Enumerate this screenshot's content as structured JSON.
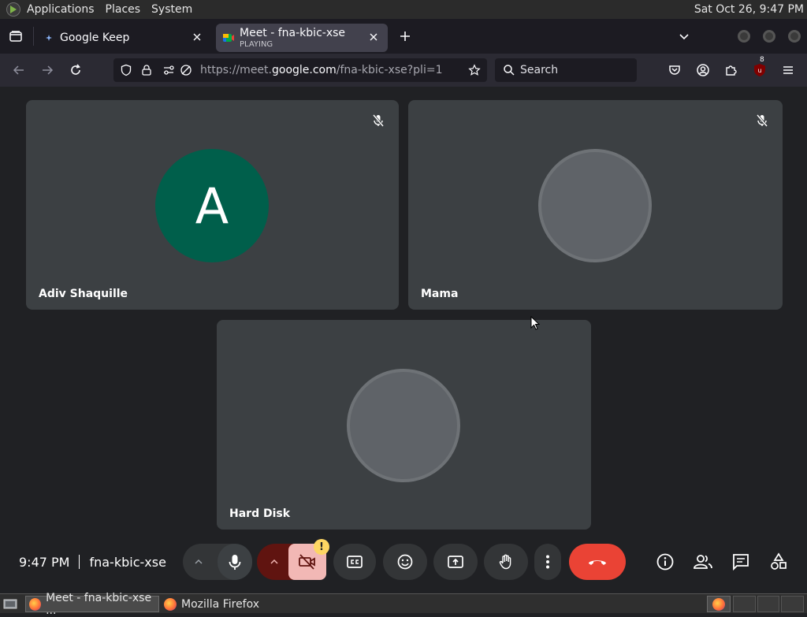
{
  "system_bar": {
    "menus": [
      "Applications",
      "Places",
      "System"
    ],
    "clock": "Sat Oct 26,  9:47 PM"
  },
  "tabs": [
    {
      "title": "Google Keep",
      "subtitle": ""
    },
    {
      "title": "Meet - fna-kbic-xse",
      "subtitle": "PLAYING"
    }
  ],
  "navbar": {
    "url_prefix": "https://meet.",
    "url_domain": "google.com",
    "url_path": "/fna-kbic-xse?pli=1",
    "search_placeholder": "Search",
    "extension_badge": "8"
  },
  "participants": [
    {
      "name": "Adiv Shaquille",
      "initial": "A",
      "avatar_color": "#005f4b",
      "muted": true
    },
    {
      "name": "Mama",
      "initial": "",
      "muted": true
    },
    {
      "name": "Hard Disk",
      "initial": "",
      "muted": false
    }
  ],
  "meeting": {
    "time": "9:47 PM",
    "code": "fna-kbic-xse"
  },
  "colors": {
    "end_call": "#ea4335",
    "camera_off_bg": "#f2b8b5",
    "camera_chevron_bg": "#601410",
    "warning": "#fdd663"
  },
  "taskbar": {
    "items": [
      "Meet - fna-kbic-xse ...",
      "Mozilla Firefox"
    ]
  }
}
